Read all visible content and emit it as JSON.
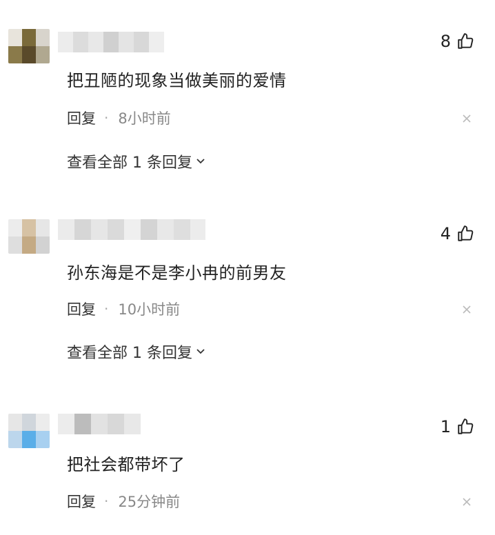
{
  "comments": [
    {
      "likes": "8",
      "text": "把丑陋的现象当做美丽的爱情",
      "reply_label": "回复",
      "time": "8小时前",
      "view_all": "查看全部 1 条回复"
    },
    {
      "likes": "4",
      "text": "孙东海是不是李小冉的前男友",
      "reply_label": "回复",
      "time": "10小时前",
      "view_all": "查看全部 1 条回复"
    },
    {
      "likes": "1",
      "text": "把社会都带坏了",
      "reply_label": "回复",
      "time": "25分钟前"
    }
  ],
  "icons": {
    "like": "thumbs-up-icon",
    "close": "close-icon",
    "expand": "chevron-down-icon"
  },
  "colors": {
    "text": "#222222",
    "meta": "#888888",
    "close": "#bbbbbb",
    "background": "#ffffff"
  }
}
